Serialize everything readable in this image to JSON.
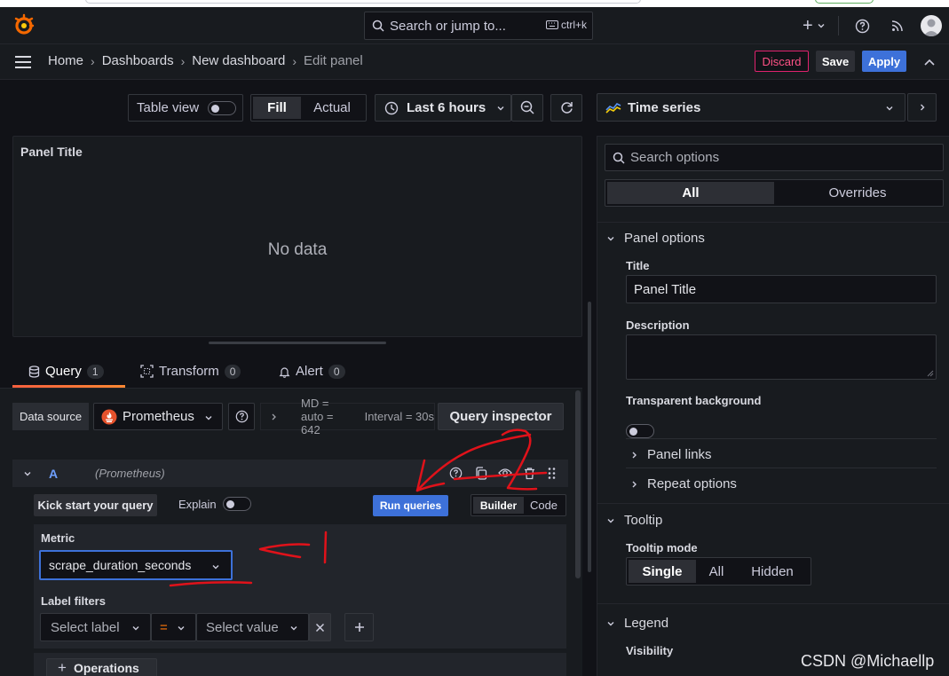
{
  "topbar": {
    "search_placeholder": "Search or jump to...",
    "shortcut": "ctrl+k"
  },
  "breadcrumb": [
    "Home",
    "Dashboards",
    "New dashboard",
    "Edit panel"
  ],
  "actions": {
    "discard": "Discard",
    "save": "Save",
    "apply": "Apply"
  },
  "toolbar": {
    "table_view": "Table view",
    "fill": "Fill",
    "actual": "Actual",
    "time_range": "Last 6 hours",
    "visualization": "Time series"
  },
  "panel": {
    "title": "Panel Title",
    "empty": "No data"
  },
  "tabs": [
    {
      "label": "Query",
      "count": "1"
    },
    {
      "label": "Transform",
      "count": "0"
    },
    {
      "label": "Alert",
      "count": "0"
    }
  ],
  "datasource": {
    "label": "Data source",
    "value": "Prometheus",
    "info": "MD = auto = 642",
    "interval": "Interval = 30s",
    "inspector": "Query inspector"
  },
  "query": {
    "ref": "A",
    "source": "(Prometheus)",
    "kick_start": "Kick start your query",
    "explain": "Explain",
    "run": "Run queries",
    "builder": "Builder",
    "code": "Code",
    "metric_label": "Metric",
    "metric_value": "scrape_duration_seconds",
    "label_filters": "Label filters",
    "select_label": "Select label",
    "operator": "=",
    "select_value": "Select value",
    "operations": "Operations"
  },
  "options": {
    "search_placeholder": "Search options",
    "tab_all": "All",
    "tab_overrides": "Overrides",
    "panel_options": "Panel options",
    "title_label": "Title",
    "title_value": "Panel Title",
    "description_label": "Description",
    "transparent_label": "Transparent background",
    "panel_links": "Panel links",
    "repeat_options": "Repeat options",
    "tooltip": "Tooltip",
    "tooltip_mode_label": "Tooltip mode",
    "tooltip_modes": [
      "Single",
      "All",
      "Hidden"
    ],
    "legend": "Legend",
    "visibility_label": "Visibility"
  },
  "annotations": {
    "one": "1",
    "two": "2"
  },
  "watermark": "CSDN @Michaellp",
  "colors": {
    "accent": "#3d71d9",
    "danger": "#f55f7e",
    "orange": "#ff780a",
    "annotation": "#e0121a"
  }
}
